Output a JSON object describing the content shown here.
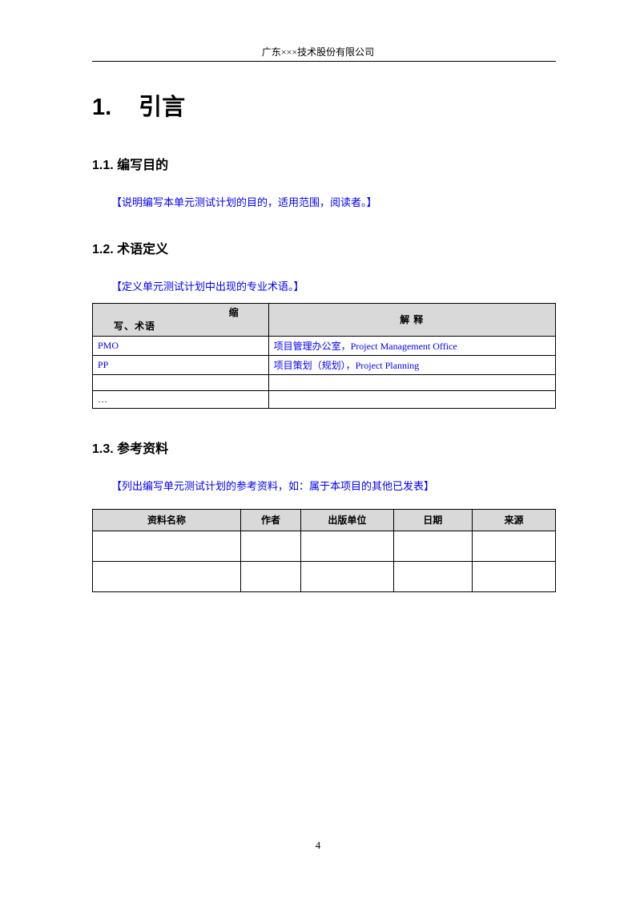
{
  "header": {
    "company": "广东×××技术股份有限公司"
  },
  "sections": {
    "s1": {
      "num": "1.",
      "title": "引言"
    },
    "s1_1": {
      "num": "1.1.",
      "title": "编写目的",
      "note": "【说明编写本单元测试计划的目的，适用范围，阅读者。】"
    },
    "s1_2": {
      "num": "1.2.",
      "title": "术语定义",
      "note": "【定义单元测试计划中出现的专业术语。】"
    },
    "s1_3": {
      "num": "1.3.",
      "title": "参考资料",
      "note": "【列出编写单元测试计划的参考资料，如：属于本项目的其他已发表】"
    }
  },
  "table1": {
    "headers": {
      "col1_line1": "缩",
      "col1_line2": "写、术语",
      "col2": "解 释"
    },
    "rows": [
      {
        "term": "PMO",
        "desc": "项目管理办公室，Project Management Office"
      },
      {
        "term": "PP",
        "desc": "项目策划（规划），Project Planning"
      },
      {
        "term": "",
        "desc": ""
      },
      {
        "term": "…",
        "desc": ""
      }
    ]
  },
  "table2": {
    "headers": {
      "c1": "资料名称",
      "c2": "作者",
      "c3": "出版单位",
      "c4": "日期",
      "c5": "来源"
    }
  },
  "page_number": "4"
}
